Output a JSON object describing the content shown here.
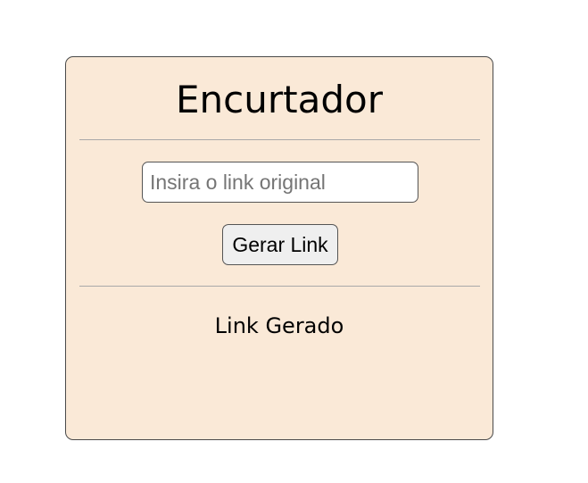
{
  "card": {
    "title": "Encurtador",
    "background": "#fae9d7"
  },
  "form": {
    "input_value": "",
    "input_placeholder": "Insira o link original",
    "button_label": "Gerar Link"
  },
  "result": {
    "label": "Link Gerado"
  }
}
